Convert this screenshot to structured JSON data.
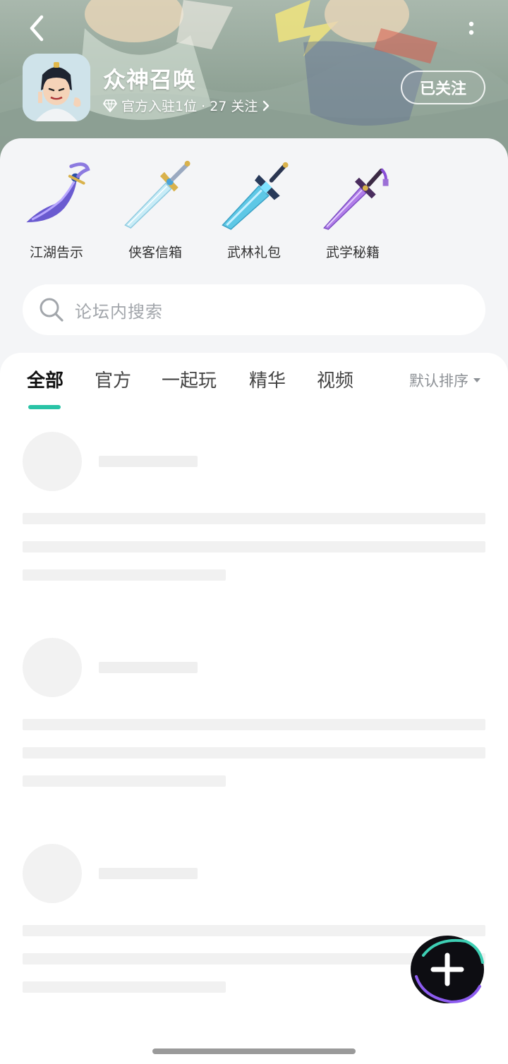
{
  "header": {
    "app_name": "众神召唤",
    "meta": "官方入驻1位 · 27 关注",
    "follow_label": "已关注"
  },
  "shortcuts": [
    {
      "label": "江湖告示",
      "icon": "curved-blade-icon",
      "color": "#7b6cd8"
    },
    {
      "label": "侠客信箱",
      "icon": "ice-sword-icon",
      "color": "#a8dcef"
    },
    {
      "label": "武林礼包",
      "icon": "broad-sword-icon",
      "color": "#57c2e4"
    },
    {
      "label": "武学秘籍",
      "icon": "purple-sword-icon",
      "color": "#9b6fd6"
    }
  ],
  "search": {
    "placeholder": "论坛内搜索"
  },
  "tabs": [
    {
      "label": "全部",
      "active": true
    },
    {
      "label": "官方",
      "active": false
    },
    {
      "label": "一起玩",
      "active": false
    },
    {
      "label": "精华",
      "active": false
    },
    {
      "label": "视频",
      "active": false
    }
  ],
  "sort": {
    "label": "默认排序"
  },
  "colors": {
    "accent": "#29c3a6",
    "sheet": "#f4f5f7",
    "skeleton": "#f1f1f1"
  }
}
